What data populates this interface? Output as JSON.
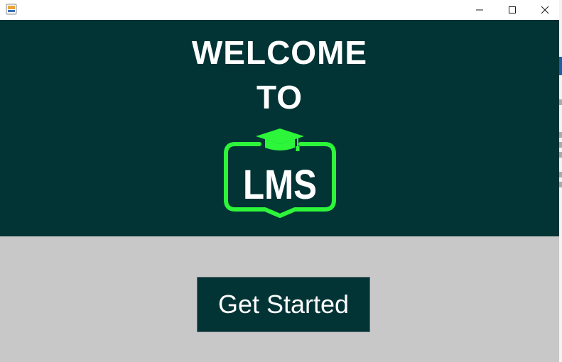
{
  "window": {
    "title": "",
    "controls": {
      "minimize_icon": "minimize-icon",
      "maximize_icon": "maximize-icon",
      "close_icon": "close-icon"
    }
  },
  "colors": {
    "header_bg": "#023335",
    "body_bg": "#c8c8c8",
    "accent_green": "#2cf53a",
    "text_white": "#ffffff"
  },
  "header": {
    "welcome_line1": "WELCOME",
    "welcome_line2": "TO",
    "logo": {
      "text": "LMS",
      "icon": "graduation-cap-icon"
    }
  },
  "main": {
    "cta_label": "Get Started"
  }
}
